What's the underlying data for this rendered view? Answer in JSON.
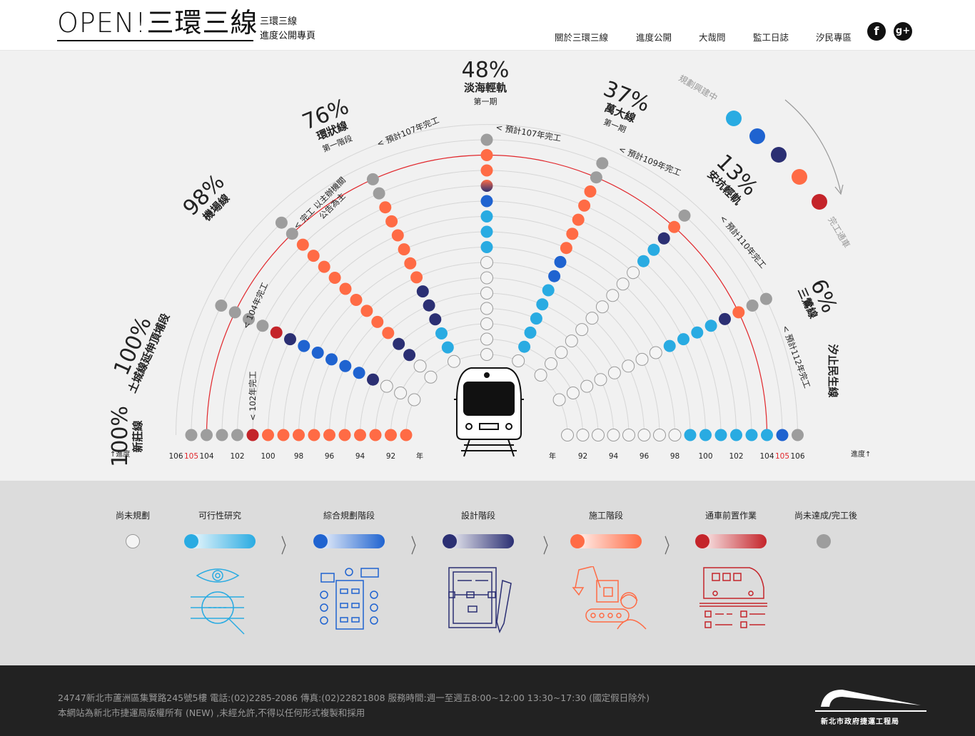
{
  "header": {
    "logo": "OPEN!三環三線",
    "subtitle_line1": "三環三線",
    "subtitle_line2": "進度公開專頁",
    "nav": [
      "關於三環三線",
      "進度公開",
      "大哉問",
      "監工日誌",
      "汐民專區"
    ],
    "social": {
      "facebook": "f",
      "googleplus": "g+"
    }
  },
  "infographic": {
    "lines": [
      {
        "name": "新莊線",
        "percent": "100%",
        "note": "102年完工"
      },
      {
        "name": "土城線延伸頂埔段",
        "percent": "100%",
        "note": "104年完工"
      },
      {
        "name": "機場線",
        "percent": "98%",
        "note": "完工 以主辦機關公告為主"
      },
      {
        "name": "環狀線",
        "sub": "第一階段",
        "percent": "76%",
        "note": "預計107年完工"
      },
      {
        "name": "淡海輕軌",
        "sub": "第一期",
        "percent": "48%",
        "note": "預計107年完工"
      },
      {
        "name": "萬大線",
        "sub": "第一期",
        "percent": "37%",
        "note": "預計109年完工"
      },
      {
        "name": "安坑輕軌",
        "percent": "13%",
        "note": "預計110年完工"
      },
      {
        "name": "三鶯線",
        "percent": "6%",
        "note": "預計112年完工"
      },
      {
        "name": "汐止民生線",
        "percent": ""
      }
    ],
    "note_main_a": "完工 以主辦機關",
    "note_main_b": "公告為主",
    "arrow_top_label": "規劃興建中",
    "arrow_bottom_label": "完工通車",
    "left_axis_label": "↑進度",
    "right_axis_label": "進度↑",
    "year_unit": "年",
    "left_years": [
      "106",
      "105",
      "104",
      "102",
      "100",
      "98",
      "96",
      "94",
      "92"
    ],
    "right_years": [
      "92",
      "94",
      "96",
      "98",
      "100",
      "102",
      "104",
      "105",
      "106"
    ],
    "highlight_year": "105",
    "colors": {
      "not_planned": "#f4f4f4",
      "feasibility": "#29abe2",
      "planning": "#1f63d0",
      "design": "#2b2f73",
      "construction": "#ff6b45",
      "pre_open": "#c4242a",
      "done": "#9d9d9d",
      "ring_highlight": "#e1262b"
    }
  },
  "legend": {
    "stages": [
      "尚未規劃",
      "可行性研究",
      "綜合規劃階段",
      "設計階段",
      "施工階段",
      "通車前置作業",
      "尚未達成/完工後"
    ]
  },
  "footer": {
    "line1": "24747新北市蘆洲區集賢路245號5樓    電話:(02)2285-2086    傳真:(02)22821808    服務時間:週一至週五8:00~12:00 13:30~17:30 (國定假日除外)",
    "line2": "本網站為新北市捷運局版權所有 (NEW) ,未經允許,不得以任何形式複製和採用",
    "org": "新北市政府捷運工程局"
  }
}
